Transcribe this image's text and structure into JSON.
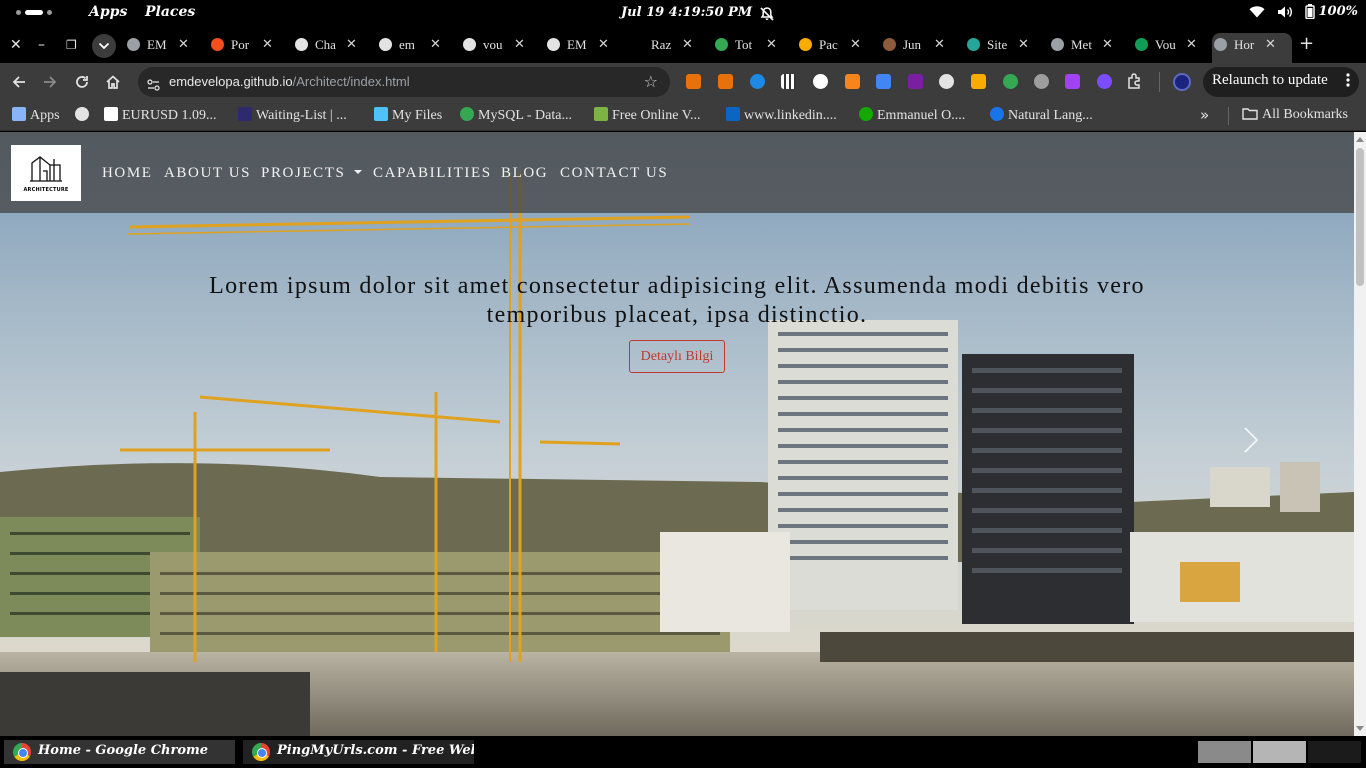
{
  "os": {
    "menu_apps": "Apps",
    "menu_places": "Places",
    "clock": "Jul 19   4:19:50 PM",
    "battery": "100%"
  },
  "tabs": [
    {
      "title": "EM",
      "favicon_color": "#9aa0a6"
    },
    {
      "title": "Por",
      "favicon_color": "#f24e1e"
    },
    {
      "title": "Cha",
      "favicon_color": "#e3e3e3"
    },
    {
      "title": "em",
      "favicon_color": "#e3e3e3"
    },
    {
      "title": "vou",
      "favicon_color": "#e3e3e3"
    },
    {
      "title": "EM",
      "favicon_color": "#e3e3e3"
    },
    {
      "title": "Raz",
      "favicon_color": "#000000"
    },
    {
      "title": "Tot",
      "favicon_color": "#34a853"
    },
    {
      "title": "Pac",
      "favicon_color": "#f9ab00"
    },
    {
      "title": "Jun",
      "favicon_color": "#8d5a3b"
    },
    {
      "title": "Site",
      "favicon_color": "#26a69a"
    },
    {
      "title": "Met",
      "favicon_color": "#9aa0a6"
    },
    {
      "title": "Vou",
      "favicon_color": "#0f9d58"
    },
    {
      "title": "Hor",
      "favicon_color": "#9aa0a6",
      "active": true
    }
  ],
  "toolbar": {
    "url_host": "emdevelopa.github.io",
    "url_path": "/Architect/index.html",
    "relaunch_label": "Relaunch to update"
  },
  "bookmarks": [
    {
      "label": "Apps",
      "icon": "apps-grid-icon",
      "color": "#8ab4f8"
    },
    {
      "label": "",
      "icon": "globe-icon",
      "color": "#e3e3e3"
    },
    {
      "label": "EURUSD 1.09...",
      "icon": "tradingview-icon",
      "color": "#ffffff"
    },
    {
      "label": "Waiting-List | ...",
      "icon": "waitlist-icon",
      "color": "#2d2a6e"
    },
    {
      "label": "My Files",
      "icon": "chevron-logo-icon",
      "color": "#4fc3f7"
    },
    {
      "label": "MySQL - Data...",
      "icon": "mysql-icon",
      "color": "#34a853"
    },
    {
      "label": "Free Online V...",
      "icon": "download-icon",
      "color": "#7cb342"
    },
    {
      "label": "www.linkedin....",
      "icon": "linkedin-icon",
      "color": "#0a66c2"
    },
    {
      "label": "Emmanuel O....",
      "icon": "upwork-icon",
      "color": "#14a800"
    },
    {
      "label": "Natural Lang...",
      "icon": "c-logo-icon",
      "color": "#1a73e8"
    }
  ],
  "all_bookmarks_label": "All Bookmarks",
  "site": {
    "logo_caption": "ARCHITECTURE",
    "nav": [
      "HOME",
      "ABOUT US",
      "PROJECTS",
      "CAPABILITIES",
      "BLOG",
      "CONTACT US"
    ],
    "hero_text": "Lorem ipsum dolor sit amet consectetur adipisicing elit. Assumenda modi debitis vero temporibus placeat, ipsa distinctio.",
    "hero_button": "Detaylı Bilgi",
    "accent_color": "#c0392b"
  },
  "taskbar": [
    {
      "label": "Home - Google Chrome"
    },
    {
      "label": "PingMyUrls.com - Free Websit..."
    }
  ]
}
